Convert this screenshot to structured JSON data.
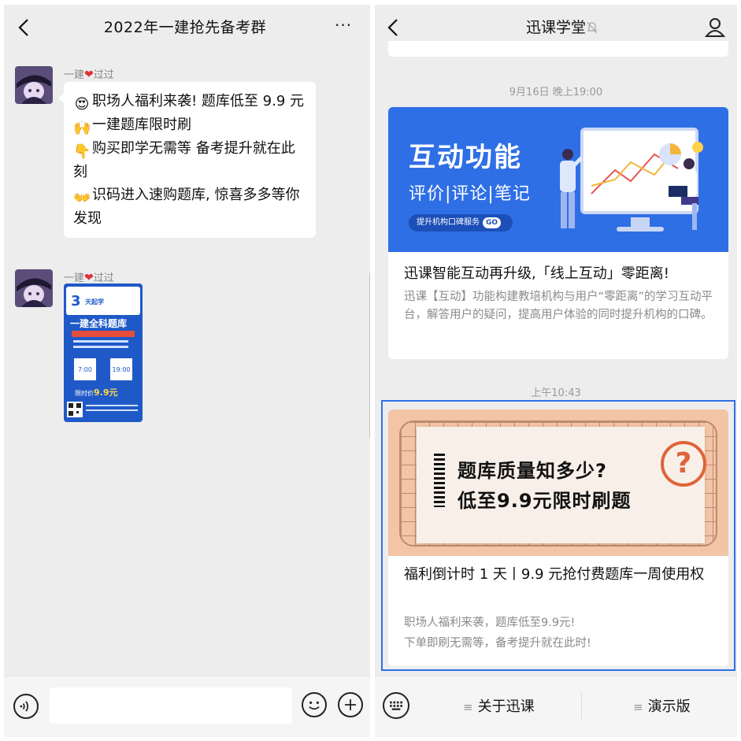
{
  "left_panel": {
    "title": "2022年一建抢先备考群",
    "more_label": "···",
    "messages": [
      {
        "sender_prefix": "一建",
        "sender_heart": "❤",
        "sender_suffix": "过过",
        "lines": [
          {
            "emoji": "😍",
            "text": "职场人福利来袭! 题库低至 9.9 元"
          },
          {
            "emoji": "🙌",
            "text": "一建题库限时刷"
          },
          {
            "emoji": "👇",
            "text": "购买即学无需等 备考提升就在此刻"
          },
          {
            "emoji": "👐",
            "text": "识码进入速购题库, 惊喜多多等你发现"
          }
        ]
      },
      {
        "sender_prefix": "一建",
        "sender_heart": "❤",
        "sender_suffix": "过过",
        "poster": {
          "big_num": "3",
          "small": "天起学",
          "title": "一建全科题库",
          "time1": "7:00",
          "time2": "19:00",
          "price_prefix": "限时价",
          "price": "9.9元"
        }
      }
    ]
  },
  "right_panel": {
    "title": "迅课学堂",
    "time1": "9月16日 晚上19:00",
    "card1": {
      "img_big": "互动功能",
      "img_sub": "评价|评论|笔记",
      "img_pill": "提升机构口碑服务",
      "img_pill_go": "GO",
      "title": "迅课智能互动再升级,「线上互动」零距离!",
      "desc": "迅课【互动】功能构建教培机构与用户“零距离”的学习互动平台，解答用户的疑问，提高用户体验的同时提升机构的口碑。"
    },
    "time2": "上午10:43",
    "card2": {
      "img_line1": "题库质量知多少?",
      "img_line2": "低至9.9元限时刷题",
      "img_q": "?",
      "title": "福利倒计时 1 天丨9.9 元抢付费题库一周使用权",
      "desc_line1": "职场人福利来袭，题库低至9.9元!",
      "desc_line2": "下单即刷无需等，备考提升就在此时!"
    },
    "menu": [
      {
        "label": "关于迅课"
      },
      {
        "label": "演示版"
      }
    ]
  },
  "colors": {
    "accent_blue": "#2f6fe6",
    "chat_bg": "#ededed",
    "heart_red": "#e0303a"
  }
}
